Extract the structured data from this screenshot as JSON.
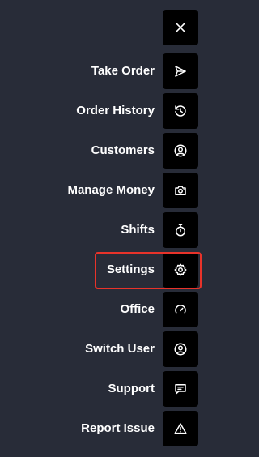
{
  "close": {
    "icon": "close-icon"
  },
  "menu": {
    "items": [
      {
        "label": "Take Order",
        "icon": "send-icon"
      },
      {
        "label": "Order History",
        "icon": "history-icon"
      },
      {
        "label": "Customers",
        "icon": "user-circle-icon"
      },
      {
        "label": "Manage Money",
        "icon": "camera-money-icon"
      },
      {
        "label": "Shifts",
        "icon": "stopwatch-icon"
      },
      {
        "label": "Settings",
        "icon": "gear-icon",
        "highlighted": true
      },
      {
        "label": "Office",
        "icon": "gauge-icon"
      },
      {
        "label": "Switch User",
        "icon": "user-circle-icon"
      },
      {
        "label": "Support",
        "icon": "message-icon"
      },
      {
        "label": "Report Issue",
        "icon": "warning-icon"
      }
    ]
  },
  "colors": {
    "background": "#282c38",
    "button": "#000000",
    "text": "#ffffff",
    "highlight": "#e8332a"
  }
}
